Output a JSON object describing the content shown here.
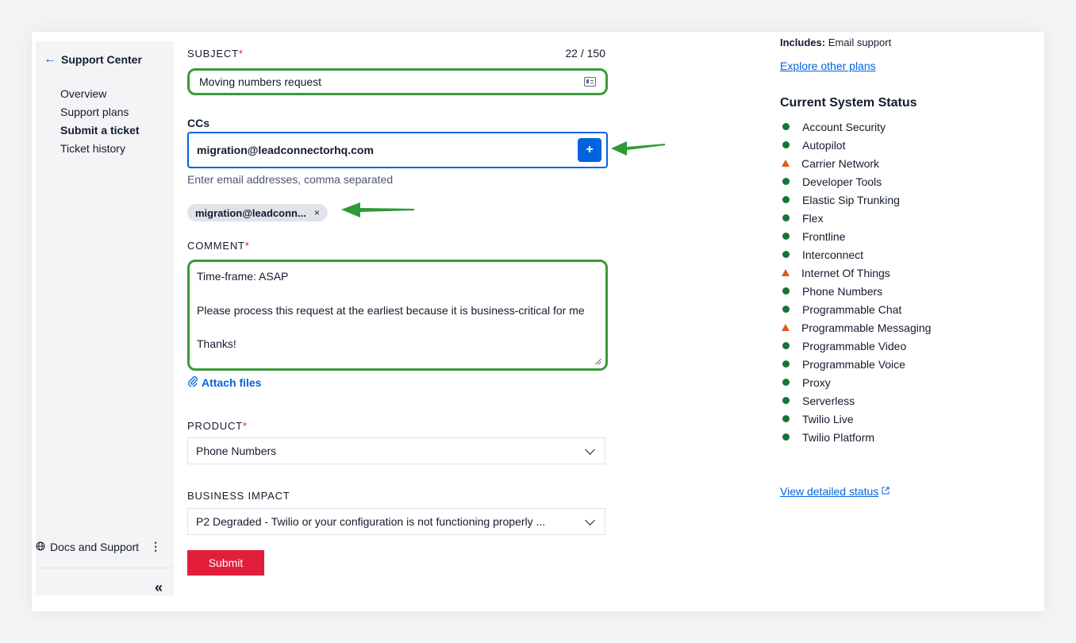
{
  "sidebar": {
    "back_label": "Support Center",
    "nav": [
      {
        "label": "Overview",
        "active": false
      },
      {
        "label": "Support plans",
        "active": false
      },
      {
        "label": "Submit a ticket",
        "active": true
      },
      {
        "label": "Ticket history",
        "active": false
      }
    ],
    "docs_label": "Docs and Support",
    "collapse_glyph": "«"
  },
  "form": {
    "subject": {
      "label": "SUBJECT",
      "required_mark": "*",
      "counter": "22 / 150",
      "value": "Moving numbers request"
    },
    "ccs": {
      "label": "CCs",
      "value": "migration@leadconnectorhq.com",
      "add_glyph": "+",
      "help": "Enter email addresses, comma separated",
      "chip": "migration@leadconn...",
      "chip_remove": "×"
    },
    "comment": {
      "label": "COMMENT",
      "required_mark": "*",
      "line1": "Time-frame: ASAP",
      "line2": "Please process this request at the earliest because it is business-critical for me",
      "line3": "Thanks!"
    },
    "attach_label": "Attach files",
    "product": {
      "label": "PRODUCT",
      "required_mark": "*",
      "value": "Phone Numbers"
    },
    "business_impact": {
      "label": "BUSINESS IMPACT",
      "value": "P2 Degraded - Twilio or your configuration is not functioning properly ..."
    },
    "submit_label": "Submit"
  },
  "right": {
    "includes_label": "Includes:",
    "includes_value": "Email support",
    "explore_link": "Explore other plans",
    "status_title": "Current System Status",
    "status": [
      {
        "name": "Account Security",
        "state": "ok"
      },
      {
        "name": "Autopilot",
        "state": "ok"
      },
      {
        "name": "Carrier Network",
        "state": "warning"
      },
      {
        "name": "Developer Tools",
        "state": "ok"
      },
      {
        "name": "Elastic Sip Trunking",
        "state": "ok"
      },
      {
        "name": "Flex",
        "state": "ok"
      },
      {
        "name": "Frontline",
        "state": "ok"
      },
      {
        "name": "Interconnect",
        "state": "ok"
      },
      {
        "name": "Internet Of Things",
        "state": "warning"
      },
      {
        "name": "Phone Numbers",
        "state": "ok"
      },
      {
        "name": "Programmable Chat",
        "state": "ok"
      },
      {
        "name": "Programmable Messaging",
        "state": "warning"
      },
      {
        "name": "Programmable Video",
        "state": "ok"
      },
      {
        "name": "Programmable Voice",
        "state": "ok"
      },
      {
        "name": "Proxy",
        "state": "ok"
      },
      {
        "name": "Serverless",
        "state": "ok"
      },
      {
        "name": "Twilio Live",
        "state": "ok"
      },
      {
        "name": "Twilio Platform",
        "state": "ok"
      }
    ],
    "detailed_link": "View detailed status",
    "detailed_icon": "external-link-icon"
  },
  "colors": {
    "accent": "#0263e0",
    "submit": "#e31e3b",
    "highlight": "#3a9a3a",
    "ok": "#14743a",
    "warning": "#e0591f",
    "annotation_arrow": "#2e9a38"
  }
}
